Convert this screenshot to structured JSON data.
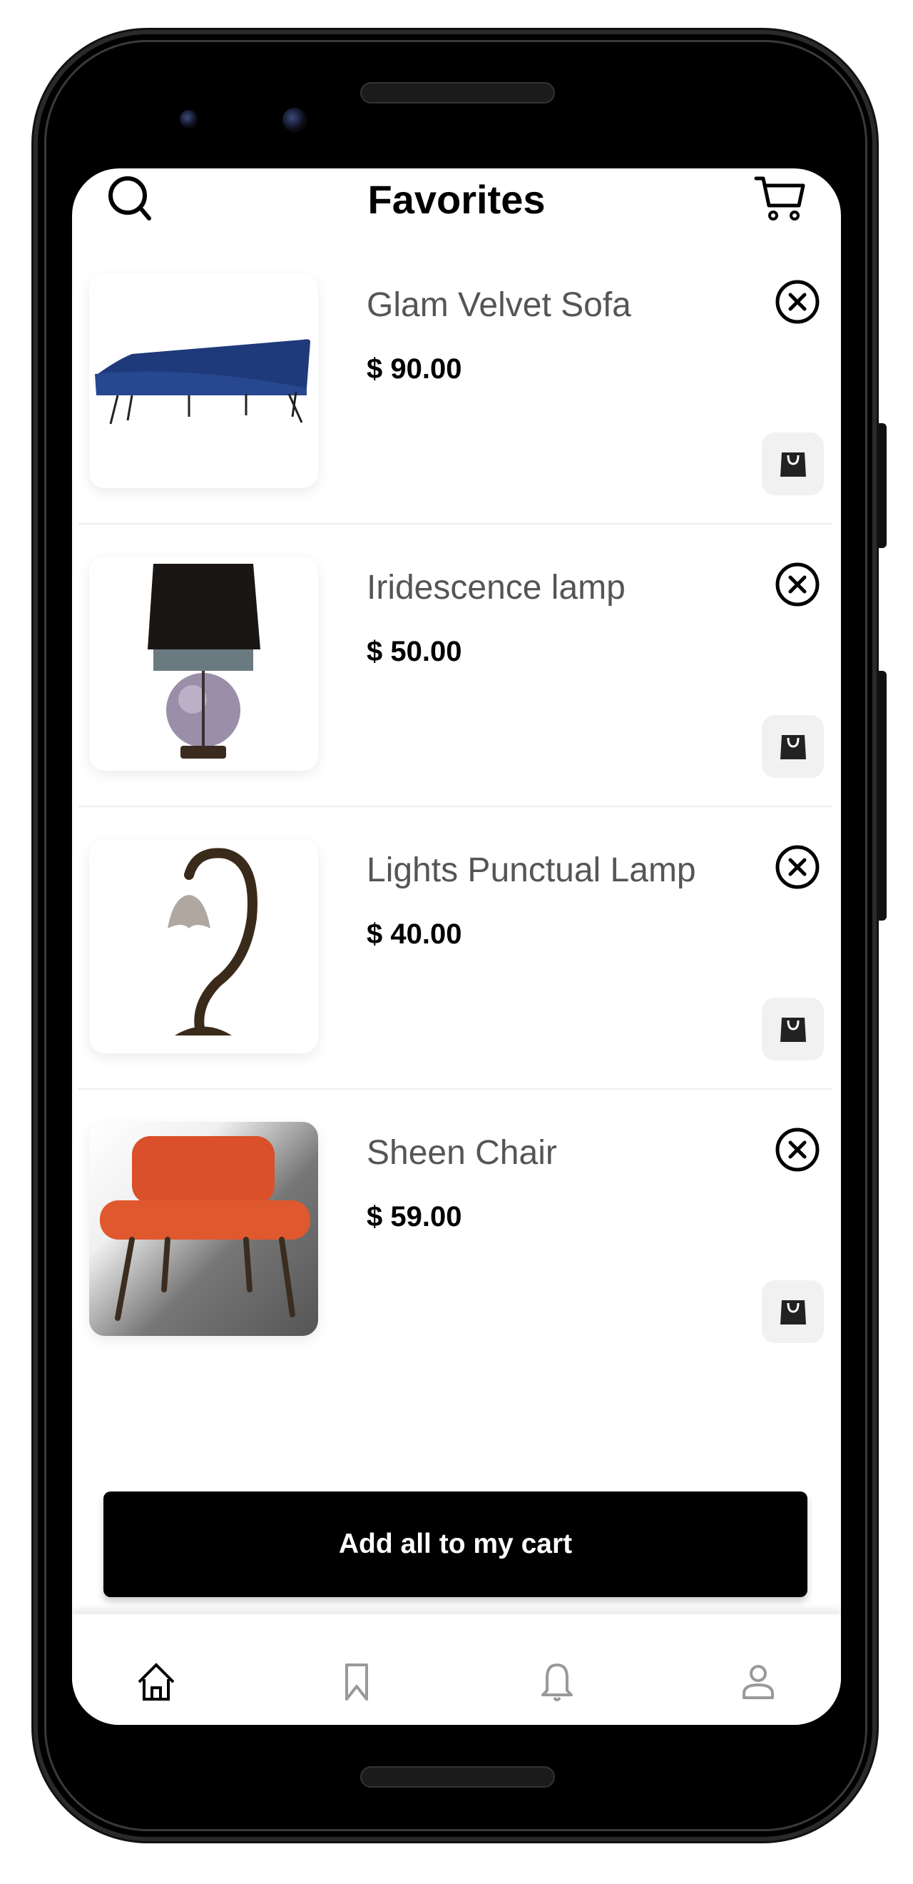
{
  "header": {
    "title": "Favorites",
    "search_icon": "search-icon",
    "cart_icon": "cart-icon"
  },
  "favorites": [
    {
      "name": "Glam Velvet Sofa",
      "price": "$ 90.00"
    },
    {
      "name": "Iridescence lamp",
      "price": "$ 50.00"
    },
    {
      "name": "Lights Punctual Lamp",
      "price": "$ 40.00"
    },
    {
      "name": "Sheen Chair",
      "price": "$ 59.00"
    }
  ],
  "actions": {
    "add_all_label": "Add all to my cart"
  },
  "bottom_nav": {
    "items": [
      {
        "icon": "home-icon",
        "active": true
      },
      {
        "icon": "bookmark-icon",
        "active": false
      },
      {
        "icon": "bell-icon",
        "active": false
      },
      {
        "icon": "profile-icon",
        "active": false
      }
    ]
  },
  "colors": {
    "primary": "#000000",
    "text_muted": "#555555",
    "inactive_icon": "#999999",
    "bag_button_bg": "#f1f1f1"
  }
}
